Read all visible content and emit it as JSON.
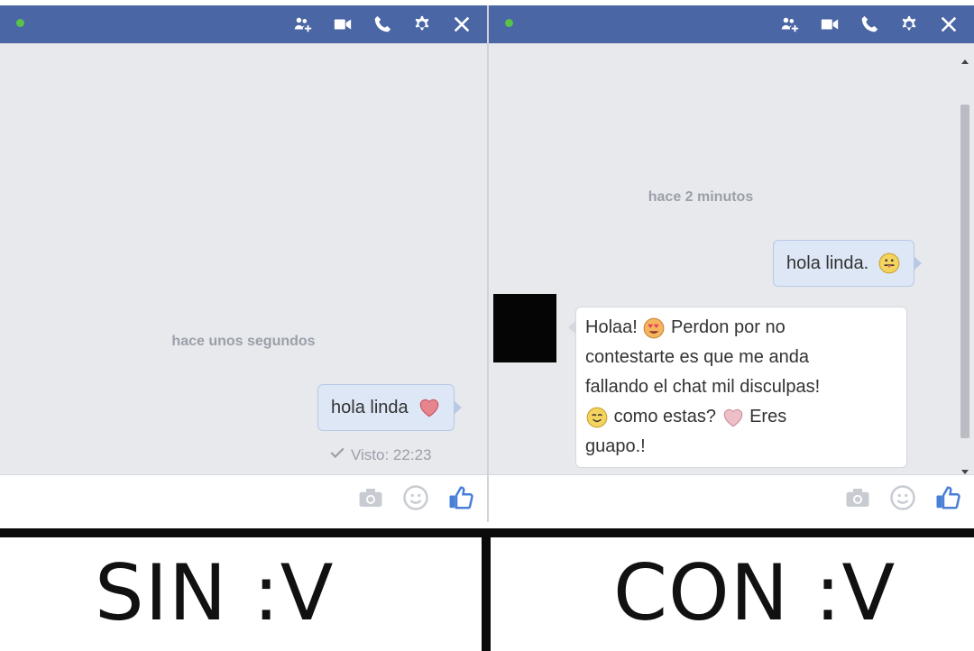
{
  "left_panel": {
    "timestamp": "hace unos segundos",
    "outgoing_message": "hola linda",
    "seen_status": "Visto: 22:23"
  },
  "right_panel": {
    "timestamp": "hace 2 minutos",
    "outgoing_message": "hola linda.",
    "incoming_message": {
      "part1": "Holaa!",
      "part2": "Perdon por no",
      "line2": "contestarte es que me anda",
      "line3": "fallando el chat mil disculpas!",
      "part4": "como estas?",
      "part5": "Eres",
      "line5": "guapo.!"
    }
  },
  "captions": {
    "left": "SIN :V",
    "right": "CON :V"
  },
  "icons": {
    "titlebar": [
      "add-friend-icon",
      "video-call-icon",
      "phone-icon",
      "gear-icon",
      "close-icon"
    ],
    "composer": [
      "camera-icon",
      "smiley-icon",
      "thumbs-up-icon"
    ],
    "emojis": [
      "heart-icon",
      "tongue-emoji-icon",
      "heart-eyes-emoji-icon",
      "smile-emoji-icon"
    ]
  },
  "colors": {
    "titlebar": "#4a66a5",
    "status_online": "#58c24a",
    "outgoing_bubble": "#dde7f6",
    "chat_background": "#e8e9ec"
  }
}
